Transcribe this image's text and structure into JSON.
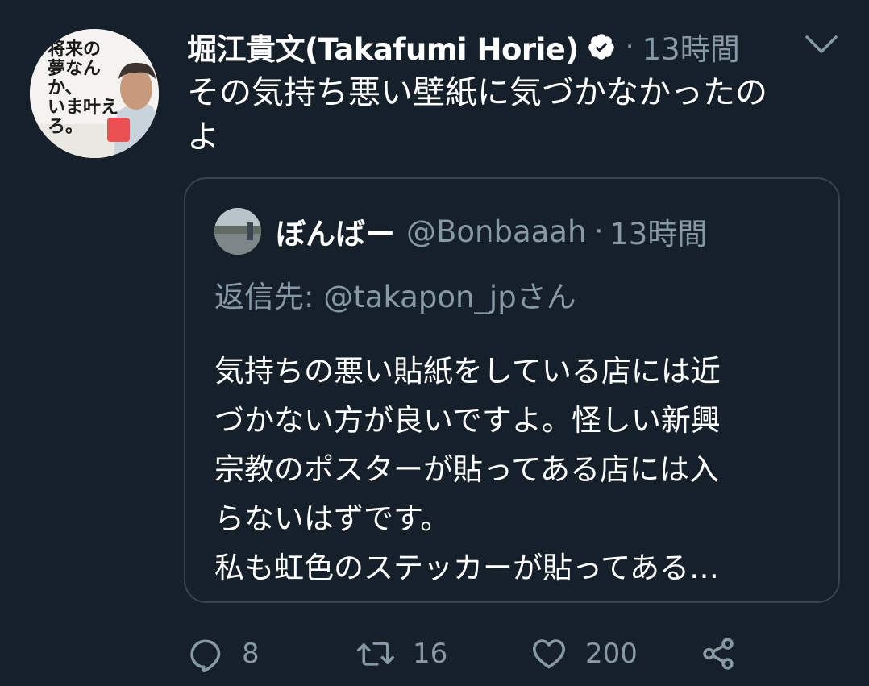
{
  "tweet": {
    "author_name": "堀江貴文(Takafumi Horie)",
    "separator": "·",
    "time": "13時間",
    "text_lines": [
      "その気持ち悪い壁紙に気づかなかったの",
      "よ"
    ],
    "avatar_text": [
      "将来の",
      "夢なんか、",
      "いま叶えろ。"
    ]
  },
  "quoted": {
    "author_name": "ぼんばー",
    "handle": "@Bonbaaah",
    "separator": "·",
    "time": "13時間",
    "reply_to": "返信先: @takapon_jpさん",
    "text_lines": [
      "気持ちの悪い貼紙をしている店には近",
      "づかない方が良いですよ。怪しい新興",
      "宗教のポスターが貼ってある店には入",
      "らないはずです。",
      "私も虹色のステッカーが貼ってある…"
    ]
  },
  "actions": {
    "reply_count": "8",
    "retweet_count": "16",
    "like_count": "200"
  },
  "icons": {
    "verified": "verified-badge-icon",
    "caret": "chevron-down-icon",
    "reply": "reply-icon",
    "retweet": "retweet-icon",
    "like": "heart-icon",
    "share": "share-icon"
  },
  "colors": {
    "background": "#15202b",
    "secondary_text": "#8899a6",
    "border": "#38444d"
  }
}
